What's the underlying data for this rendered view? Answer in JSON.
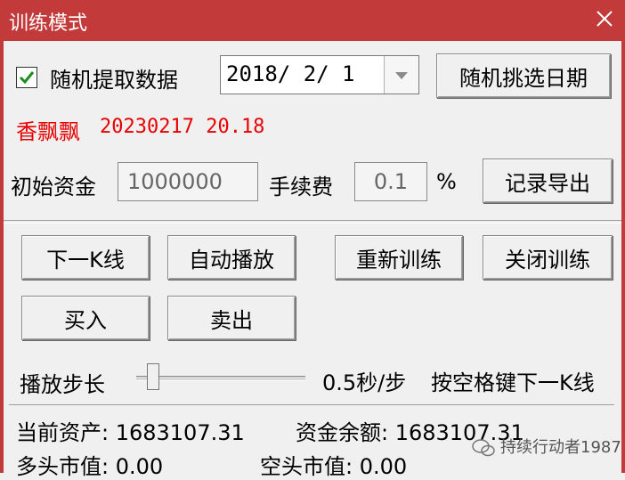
{
  "window": {
    "title": "训练模式"
  },
  "options": {
    "random_checkbox_label": "随机提取数据",
    "random_checked": true,
    "date_value": "2018/ 2/ 1",
    "random_date_button": "随机挑选日期"
  },
  "stock": {
    "name": "香飘飘",
    "info": "20230217  20.18"
  },
  "capital": {
    "initial_label": "初始资金",
    "initial_value": "1000000",
    "fee_label": "手续费",
    "fee_value": "0.1",
    "fee_unit": "%",
    "export_button": "记录导出"
  },
  "actions": {
    "next_k": "下一K线",
    "auto_play": "自动播放",
    "retrain": "重新训练",
    "close_training": "关闭训练",
    "buy": "买入",
    "sell": "卖出"
  },
  "playback": {
    "step_label": "播放步长",
    "step_value": "0.5秒/步",
    "hint": "按空格键下一K线",
    "slider_fraction": 0.1
  },
  "status": {
    "current_assets": "当前资产: 1683107.31",
    "cash_balance": "资金余额: 1683107.31",
    "long_value": "多头市值: 0.00",
    "short_value": "空头市值: 0.00"
  },
  "watermark": {
    "text": "持续行动者1987"
  },
  "colors": {
    "titlebar": "#c33a3a",
    "stock_red": "#e60000",
    "check_green": "#1a8f1a"
  }
}
